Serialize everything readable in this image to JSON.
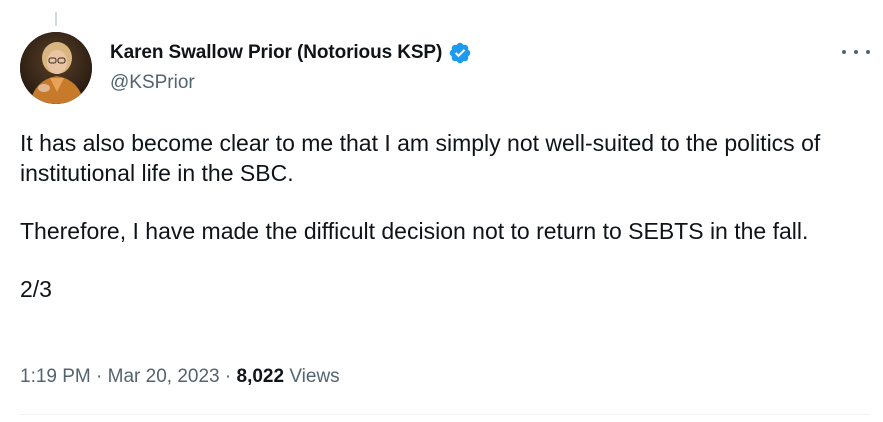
{
  "author": {
    "display_name": "Karen Swallow Prior (Notorious KSP)",
    "handle": "@KSPrior",
    "verified": true
  },
  "tweet": {
    "paragraph_1": "It has also become clear to me that I am simply not well-suited to the politics of institutional life in the SBC.",
    "paragraph_2": "Therefore, I have made the difficult decision not to return to SEBTS in the fall.",
    "paragraph_3": "2/3"
  },
  "meta": {
    "time": "1:19 PM",
    "separator": " · ",
    "date": "Mar 20, 2023",
    "view_count": "8,022",
    "views_label": "Views"
  },
  "icons": {
    "verified": "verified-badge-icon",
    "more": "more-horizontal-icon"
  },
  "colors": {
    "verified_blue": "#1d9bf0",
    "secondary_text": "#536471",
    "primary_text": "#0f1419"
  }
}
